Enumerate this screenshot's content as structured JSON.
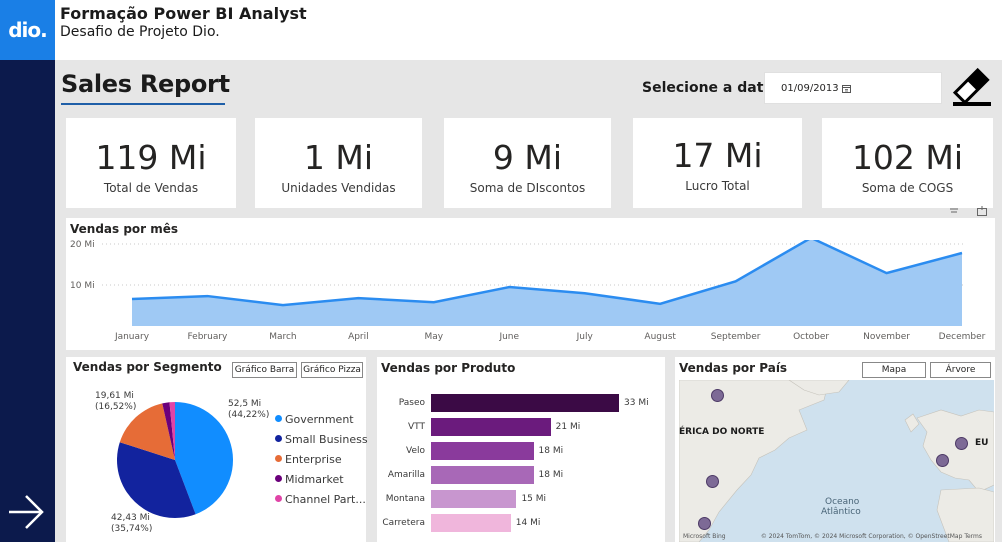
{
  "header": {
    "logo_text": "dio.",
    "title": "Formação Power BI Analyst",
    "subtitle": "Desafio de Projeto Dio."
  },
  "report": {
    "title": "Sales Report",
    "date_label": "Selecione a data",
    "date_value": "01/09/2013"
  },
  "kpis": [
    {
      "value": "119 Mi",
      "label": "Total de Vendas"
    },
    {
      "value": "1 Mi",
      "label": "Unidades Vendidas"
    },
    {
      "value": "9 Mi",
      "label": "Soma de DIscontos"
    },
    {
      "value": "17 Mi",
      "label": "Lucro Total"
    },
    {
      "value": "102 Mi",
      "label": "Soma de COGS"
    }
  ],
  "monthly": {
    "title": "Vendas por mês",
    "y_ticks": [
      "20 Mi",
      "10 Mi"
    ]
  },
  "segment": {
    "title": "Vendas por Segmento",
    "btn_bar": "Gráfico Barra",
    "btn_pie": "Gráfico Pizza",
    "labels": {
      "government": [
        "52,5 Mi",
        "(44,22%)"
      ],
      "small_business": [
        "42,43 Mi",
        "(35,74%)"
      ],
      "enterprise": [
        "19,61 Mi",
        "(16,52%)"
      ]
    }
  },
  "product": {
    "title": "Vendas por Produto"
  },
  "country": {
    "title": "Vendas por País",
    "btn_map": "Mapa",
    "btn_tree": "Árvore",
    "map_label_na": "ÉRICA DO NORTE",
    "map_label_eu": "EU",
    "map_label_ocean_1": "Oceano",
    "map_label_ocean_2": "Atlântico",
    "attribution": "© 2024 TomTom, © 2024 Microsoft Corporation, © OpenStreetMap  Terms",
    "ms_bing": "Microsoft Bing"
  },
  "colors": {
    "accent_blue": "#118dff",
    "navy": "#12239e",
    "orange": "#e66c37",
    "purple": "#6b007b",
    "pink": "#e044a7",
    "line_fill": "#9fc9f4",
    "line_stroke": "#2b8cf0"
  },
  "chart_data": [
    {
      "type": "area",
      "title": "Vendas por mês",
      "categories": [
        "January",
        "February",
        "March",
        "April",
        "May",
        "June",
        "July",
        "August",
        "September",
        "October",
        "November",
        "December"
      ],
      "values": [
        6.6,
        7.3,
        5.1,
        6.8,
        5.8,
        9.5,
        8.0,
        5.4,
        10.9,
        21.5,
        12.9,
        17.8
      ],
      "y_ticks": [
        10,
        20
      ],
      "ylim": [
        0,
        25
      ],
      "grid": true
    },
    {
      "type": "pie",
      "title": "Vendas por Segmento",
      "categories": [
        "Government",
        "Small Business",
        "Enterprise",
        "Midmarket",
        "Channel Part..."
      ],
      "values": [
        52.5,
        42.43,
        19.61,
        2.38,
        1.8
      ],
      "percent": [
        44.22,
        35.74,
        16.52,
        2.0,
        1.52
      ],
      "colors": [
        "#118dff",
        "#12239e",
        "#e66c37",
        "#6b007b",
        "#e044a7"
      ],
      "legend": "right"
    },
    {
      "type": "bar",
      "title": "Vendas por Produto",
      "orientation": "horizontal",
      "categories": [
        "Paseo",
        "VTT",
        "Velo",
        "Amarilla",
        "Montana",
        "Carretera"
      ],
      "values": [
        33,
        21,
        18,
        18,
        15,
        14
      ],
      "value_labels": [
        "33 Mi",
        "21 Mi",
        "18 Mi",
        "18 Mi",
        "15 Mi",
        "14 Mi"
      ],
      "colors": [
        "#3b0a45",
        "#6b1b7d",
        "#8a3a9c",
        "#a868b7",
        "#c896cf",
        "#f0b6dc"
      ]
    }
  ]
}
